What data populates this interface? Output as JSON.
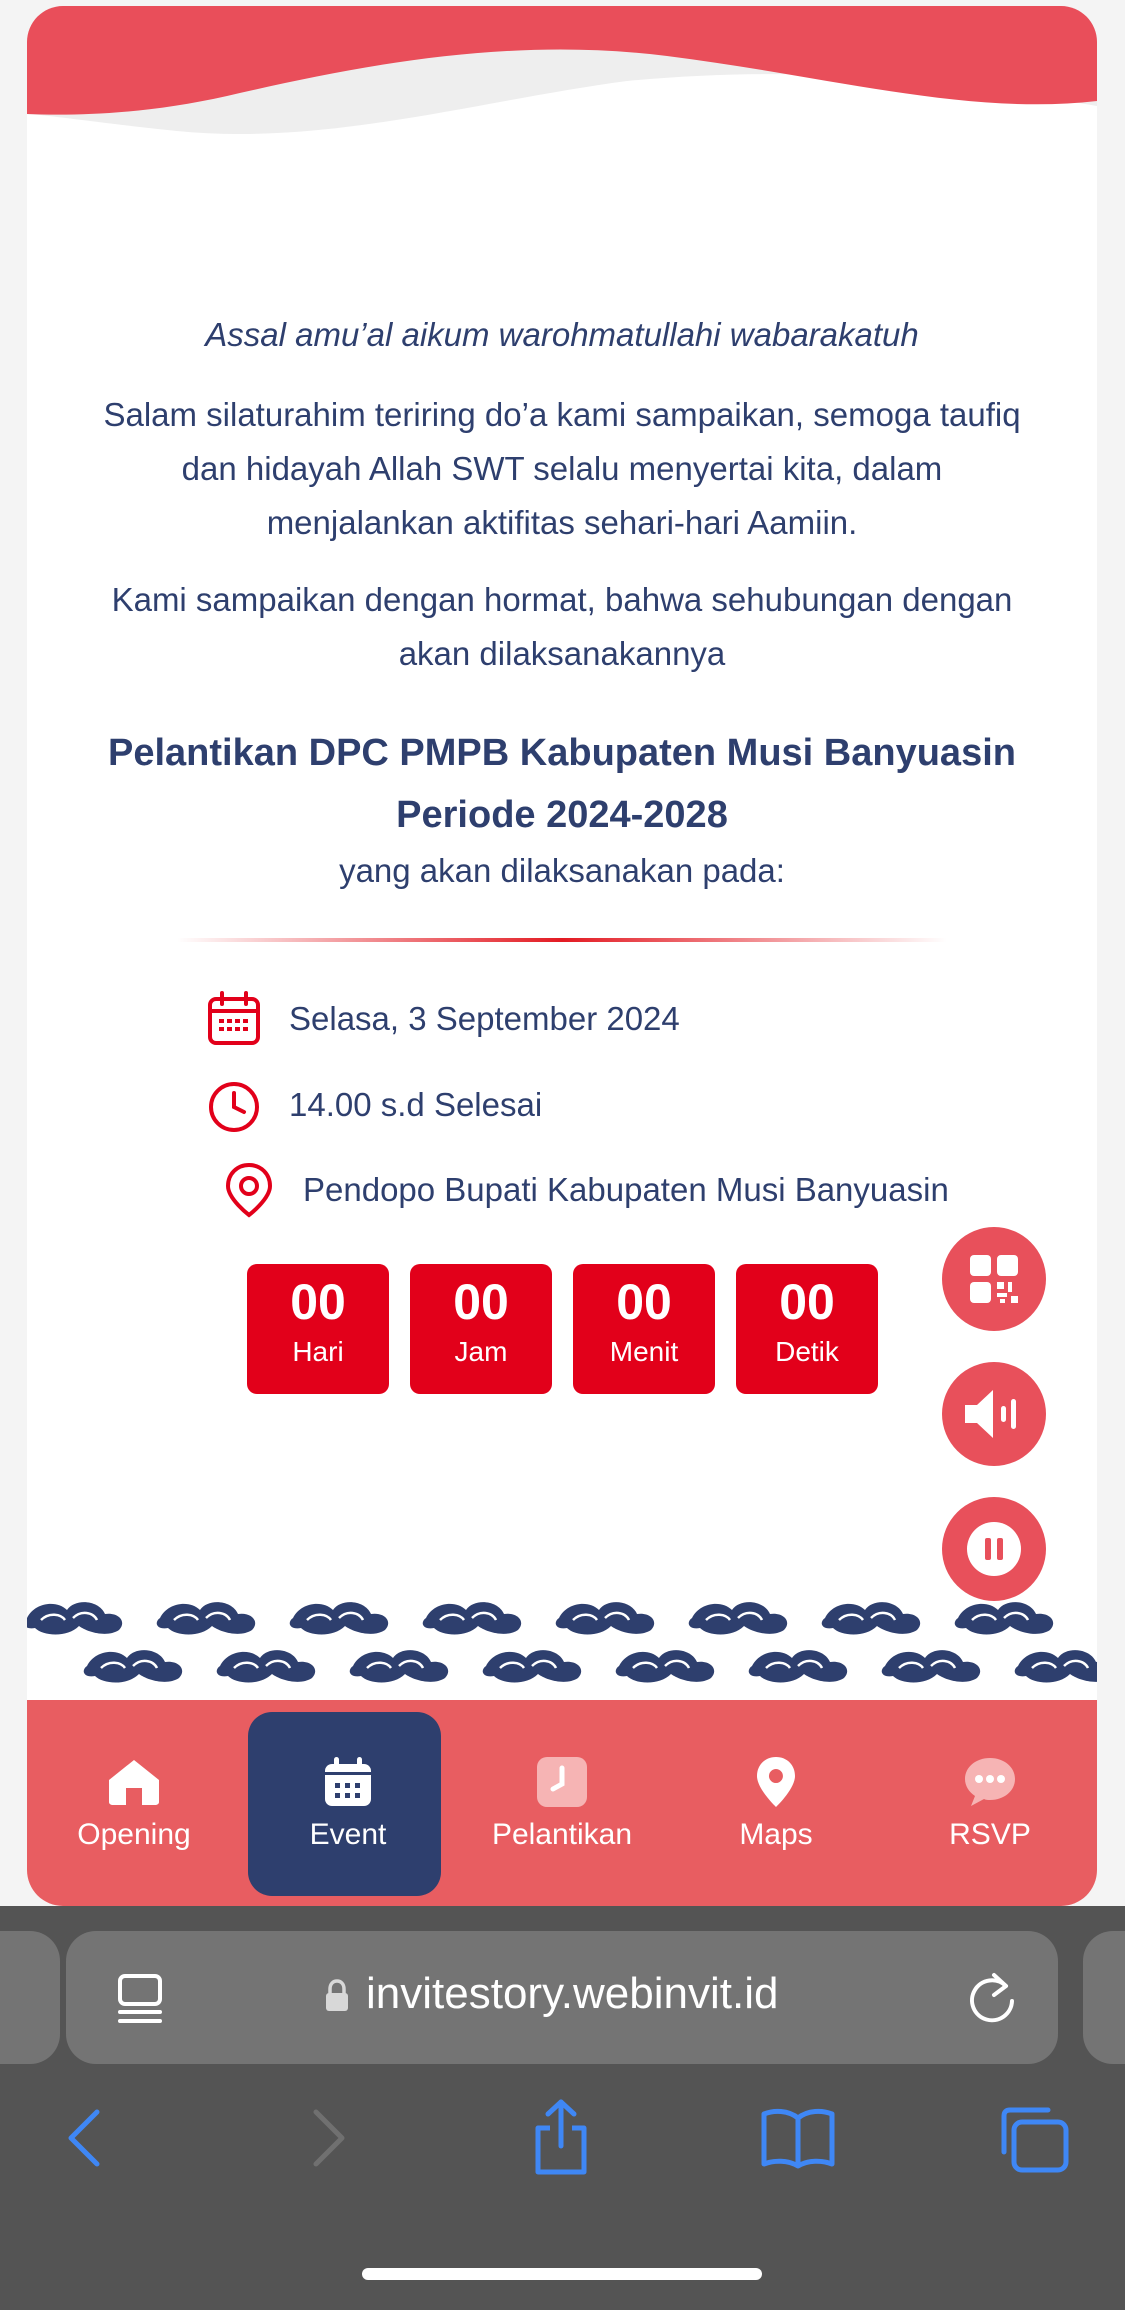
{
  "greeting": {
    "salam": "Assal amu’al aikum warohmatullahi wabarakatuh",
    "para1": "Salam silaturahim teriring do’a kami sampaikan, semoga taufiq dan hidayah Allah SWT selalu menyertai kita, dalam menjalankan aktifitas sehari-hari Aamiin.",
    "para2": "Kami sampaikan dengan hormat, bahwa sehubungan dengan akan dilaksanakannya",
    "event_title_line1": "Pelantikan DPC PMPB Kabupaten Musi Banyuasin",
    "event_title_line2": "Periode 2024-2028",
    "event_sub": "yang akan dilaksanakan pada:"
  },
  "details": {
    "date": "Selasa, 3 September 2024",
    "time": "14.00 s.d Selesai",
    "place": "Pendopo Bupati Kabupaten Musi Banyuasin"
  },
  "countdown": [
    {
      "value": "00",
      "label": "Hari"
    },
    {
      "value": "00",
      "label": "Jam"
    },
    {
      "value": "00",
      "label": "Menit"
    },
    {
      "value": "00",
      "label": "Detik"
    }
  ],
  "fabs": [
    "qr-code-icon",
    "speaker-icon",
    "pause-icon"
  ],
  "nav": [
    {
      "label": "Opening",
      "icon": "home-icon",
      "active": false
    },
    {
      "label": "Event",
      "icon": "calendar-icon",
      "active": true
    },
    {
      "label": "Pelantikan",
      "icon": "clock-icon",
      "active": false
    },
    {
      "label": "Maps",
      "icon": "map-pin-icon",
      "active": false
    },
    {
      "label": "RSVP",
      "icon": "chat-icon",
      "active": false
    }
  ],
  "browser": {
    "url": "invitestory.webinvit.id"
  },
  "colors": {
    "navy": "#2e3f6e",
    "red": "#e2001a",
    "nav_bg": "#e85d61",
    "fab_bg": "#e8505b",
    "ios_blue": "#3f87f5"
  }
}
